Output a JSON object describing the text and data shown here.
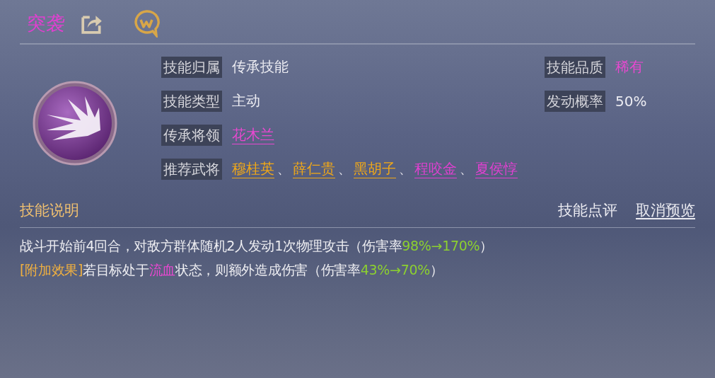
{
  "header": {
    "title": "突袭"
  },
  "info_left": [
    {
      "label": "技能归属",
      "kind": "text",
      "value": "传承技能"
    },
    {
      "label": "技能类型",
      "kind": "text",
      "value": "主动"
    },
    {
      "label": "传承将领",
      "kind": "link",
      "value": "花木兰"
    },
    {
      "label": "推荐武将",
      "kind": "generals",
      "generals": [
        {
          "name": "穆桂英",
          "color": "#f0a818"
        },
        {
          "name": "薛仁贵",
          "color": "#f0a818"
        },
        {
          "name": "黑胡子",
          "color": "#f0a818"
        },
        {
          "name": "程咬金",
          "color": "#e040d0"
        },
        {
          "name": "夏侯惇",
          "color": "#e040d0"
        }
      ],
      "separator": "、"
    }
  ],
  "info_right": [
    {
      "label": "技能品质",
      "kind": "highlight",
      "value": "稀有"
    },
    {
      "label": "发动概率",
      "kind": "text",
      "value": "50%"
    }
  ],
  "section": {
    "title": "技能说明",
    "review_button": "技能点评",
    "cancel_button": "取消预览"
  },
  "description": [
    [
      {
        "kind": "plain",
        "text": "战斗开始前4回合，对敌方群体随机2人发动1次物理攻击（伤害率"
      },
      {
        "kind": "value",
        "text": "98%→170%"
      },
      {
        "kind": "plain",
        "text": "）"
      }
    ],
    [
      {
        "kind": "tag",
        "text": "[附加效果]"
      },
      {
        "kind": "plain",
        "text": "若目标处于"
      },
      {
        "kind": "keyword",
        "text": "流血"
      },
      {
        "kind": "plain",
        "text": "状态，则额外造成伤害（伤害率"
      },
      {
        "kind": "value",
        "text": "43%→70%"
      },
      {
        "kind": "plain",
        "text": "）"
      }
    ]
  ]
}
